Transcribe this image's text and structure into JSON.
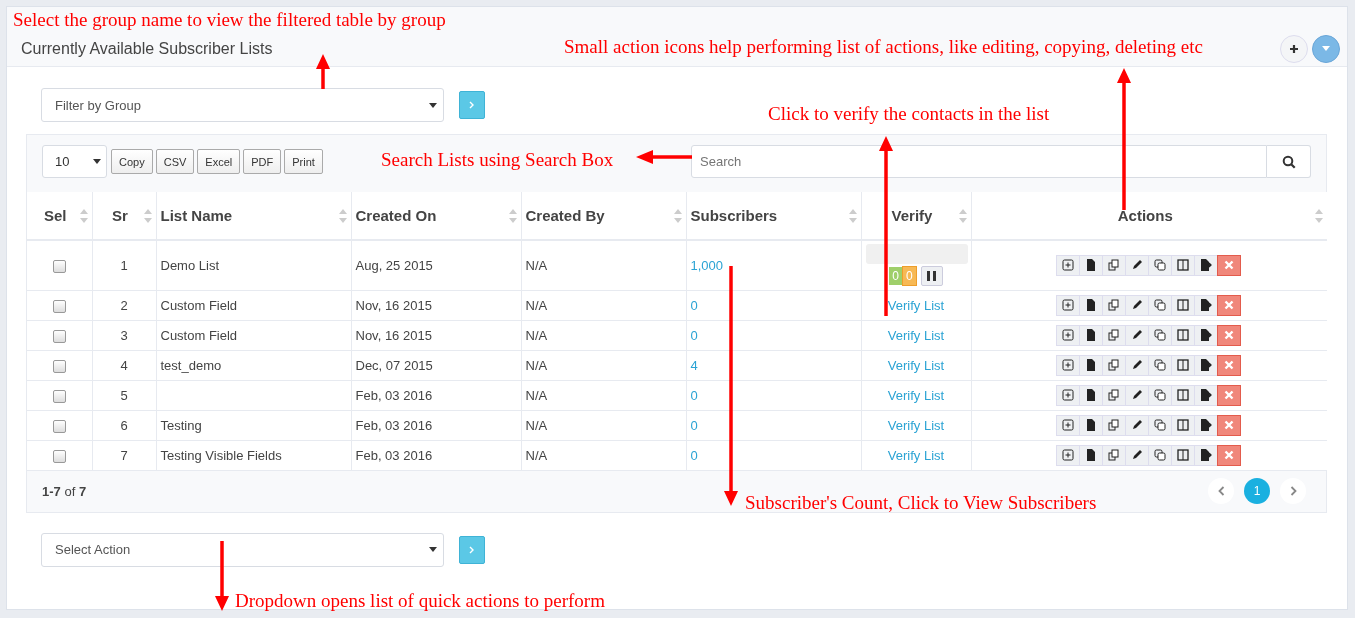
{
  "panel": {
    "title": "Currently Available Subscriber Lists"
  },
  "filter": {
    "placeholder": "Filter by Group"
  },
  "toolbar": {
    "page_size": "10",
    "buttons": [
      "Copy",
      "CSV",
      "Excel",
      "PDF",
      "Print"
    ],
    "search": {
      "placeholder": "Search"
    }
  },
  "table": {
    "columns": [
      "Sel",
      "Sr",
      "List Name",
      "Created On",
      "Created By",
      "Subscribers",
      "Verify",
      "Actions"
    ],
    "rows": [
      {
        "checked": false,
        "sr": "1",
        "name": "Demo List",
        "created_on": "Aug, 25 2015",
        "created_by": "N/A",
        "subscribers": "1,000",
        "verify": {
          "kind": "progress",
          "counts": [
            "0",
            "0"
          ]
        }
      },
      {
        "checked": false,
        "sr": "2",
        "name": "Custom Field",
        "created_on": "Nov, 16 2015",
        "created_by": "N/A",
        "subscribers": "0",
        "verify": {
          "kind": "link",
          "text": "Verify List"
        }
      },
      {
        "checked": false,
        "sr": "3",
        "name": "Custom Field",
        "created_on": "Nov, 16 2015",
        "created_by": "N/A",
        "subscribers": "0",
        "verify": {
          "kind": "link",
          "text": "Verify List"
        }
      },
      {
        "checked": false,
        "sr": "4",
        "name": "test_demo",
        "created_on": "Dec, 07 2015",
        "created_by": "N/A",
        "subscribers": "4",
        "verify": {
          "kind": "link",
          "text": "Verify List"
        }
      },
      {
        "checked": false,
        "sr": "5",
        "name": "",
        "created_on": "Feb, 03 2016",
        "created_by": "N/A",
        "subscribers": "0",
        "verify": {
          "kind": "link",
          "text": "Verify List"
        }
      },
      {
        "checked": false,
        "sr": "6",
        "name": "Testing",
        "created_on": "Feb, 03 2016",
        "created_by": "N/A",
        "subscribers": "0",
        "verify": {
          "kind": "link",
          "text": "Verify List"
        }
      },
      {
        "checked": false,
        "sr": "7",
        "name": "Testing Visible Fields",
        "created_on": "Feb, 03 2016",
        "created_by": "N/A",
        "subscribers": "0",
        "verify": {
          "kind": "link",
          "text": "Verify List"
        }
      }
    ]
  },
  "footer": {
    "range": "**1-7** of **7**",
    "pages": [
      {
        "label": "1",
        "selected": true
      }
    ]
  },
  "action_select": {
    "placeholder": "Select Action"
  },
  "annotations": [
    "Select the group name to view the filtered table by group",
    "Small action icons help performing list of actions, like editing, copying, deleting etc",
    "Click to verify the contacts in the list",
    "Search Lists using Search Box",
    "Subscriber's Count, Click to View Subscribers",
    "Dropdown opens list of quick actions to perform"
  ]
}
